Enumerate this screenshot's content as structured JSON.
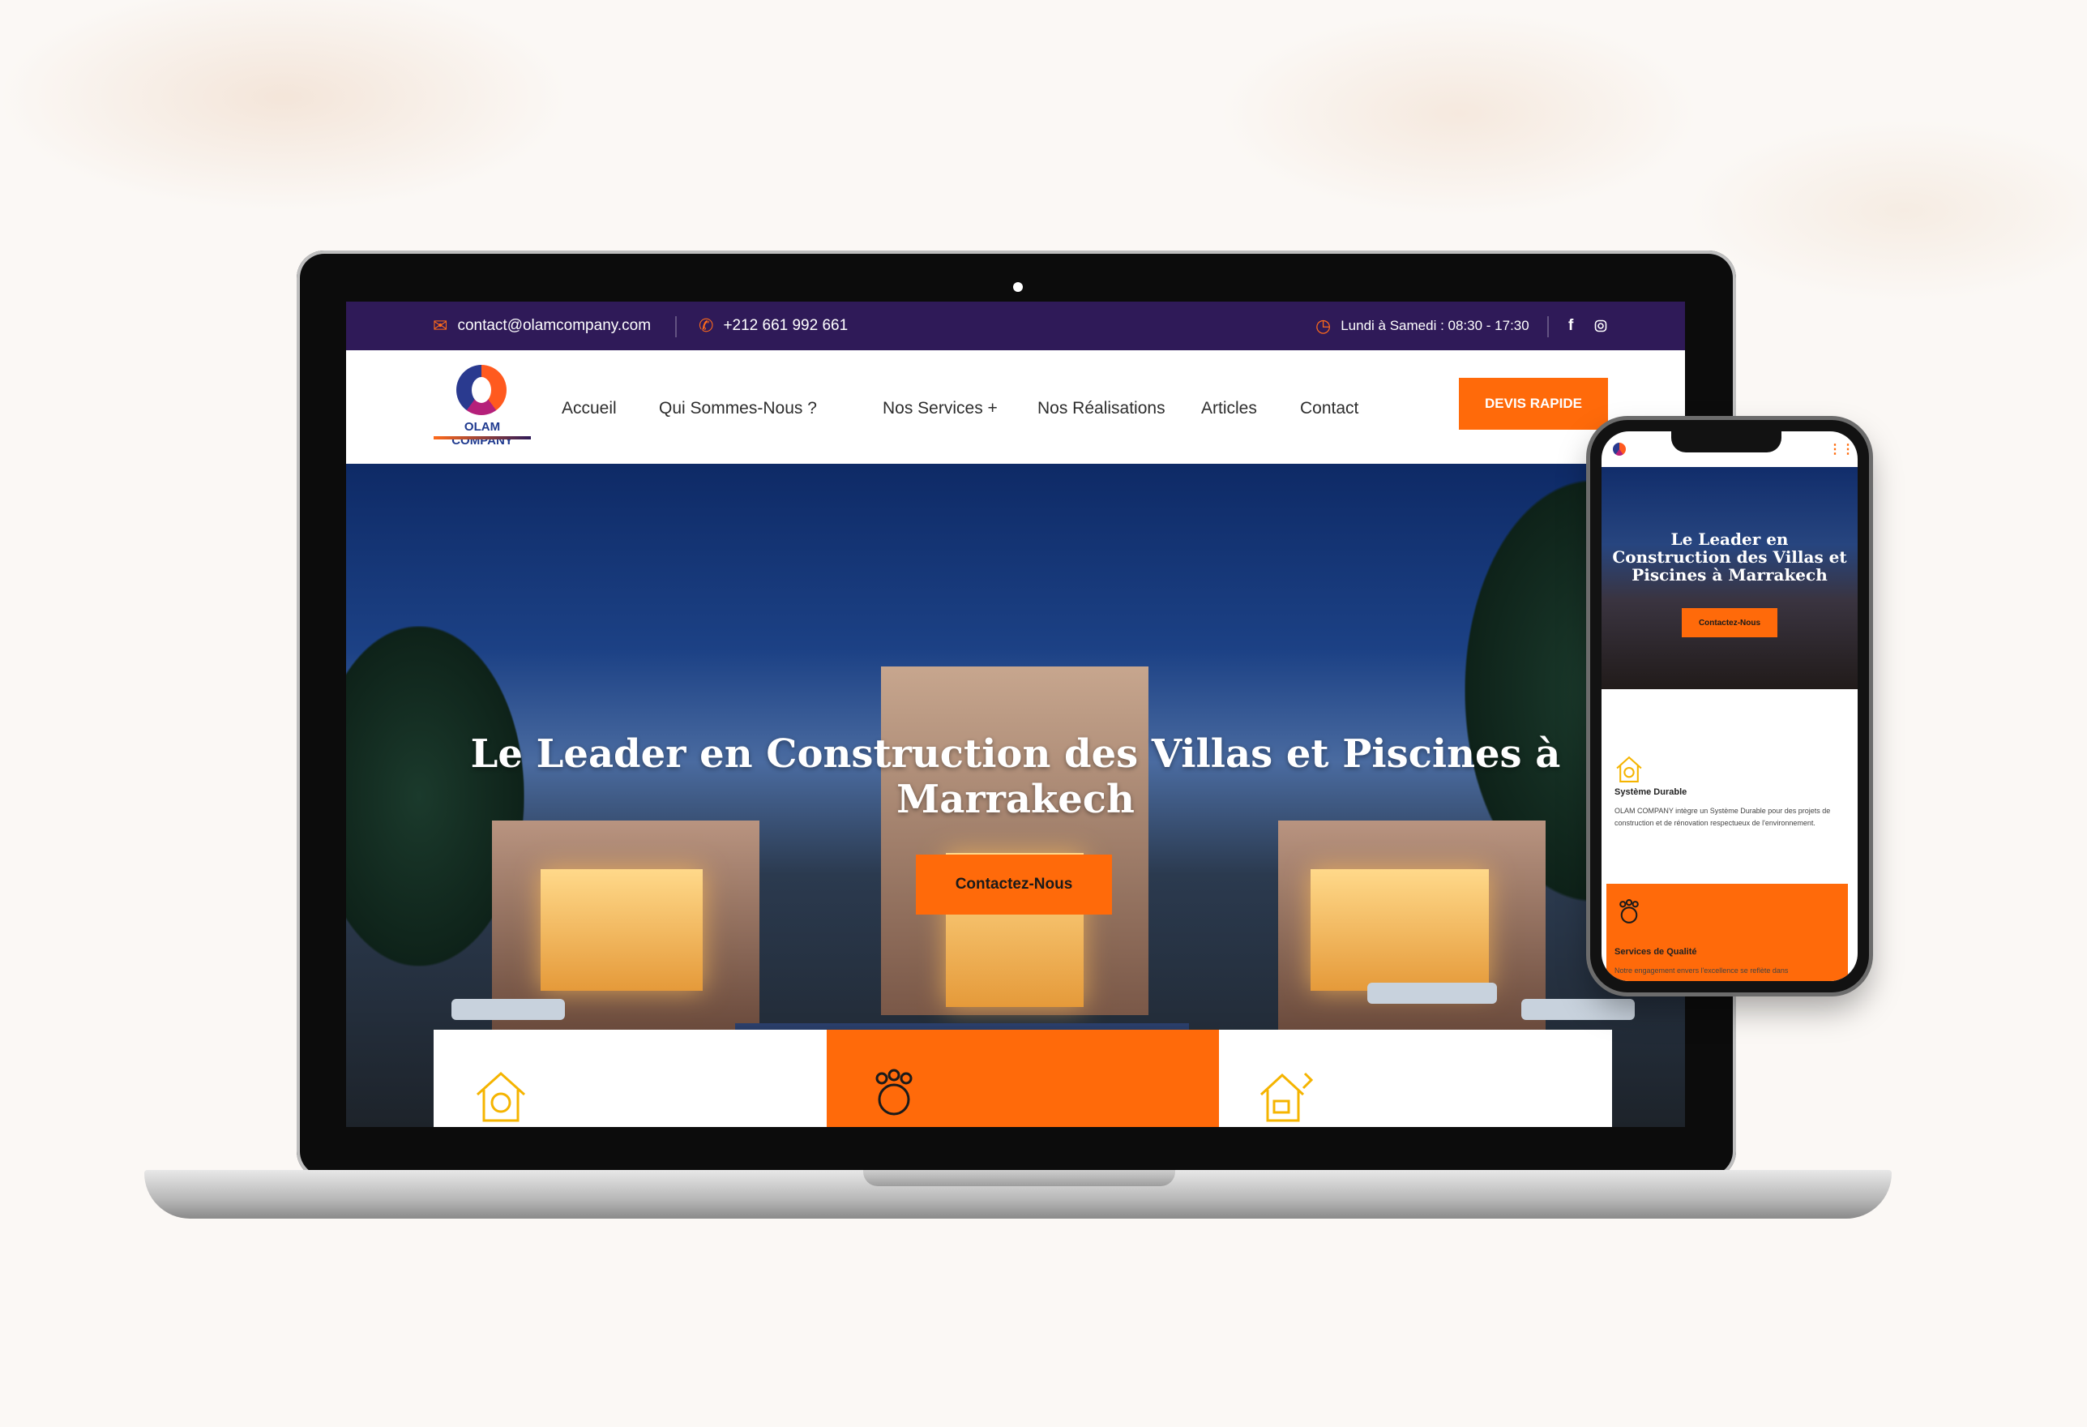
{
  "desktop": {
    "topbar": {
      "email": "contact@olamcompany.com",
      "phone": "+212 661 992 661",
      "hours": "Lundi à Samedi : 08:30 - 17:30",
      "social": [
        "facebook-icon",
        "instagram-icon"
      ]
    },
    "logo": {
      "name": "OLAM COMPANY"
    },
    "nav": [
      "Accueil",
      "Qui Sommes-Nous ?",
      "Nos Services +",
      "Nos Réalisations",
      "Articles",
      "Contact"
    ],
    "cta": "DEVIS RAPIDE",
    "hero": {
      "title": "Le Leader en Construction des Villas et Piscines à Marrakech",
      "button": "Contactez-Nous"
    },
    "features": [
      "eco-house-icon",
      "team-gear-icon",
      "house-tools-icon"
    ]
  },
  "mobile": {
    "hero": {
      "title": "Le Leader en Construction des Villas et Piscines à Marrakech",
      "button": "Contactez-Nous"
    },
    "cards": [
      {
        "icon": "eco-house-icon",
        "title": "Système Durable",
        "text": "OLAM COMPANY intègre un Système Durable pour des projets de construction et de rénovation respectueux de l'environnement."
      },
      {
        "icon": "team-gear-icon",
        "title": "Services de Qualité",
        "text": "Notre engagement envers l'excellence se reflète dans"
      }
    ]
  },
  "colors": {
    "accent": "#ff6a0a",
    "topbar": "#2f1a58"
  }
}
